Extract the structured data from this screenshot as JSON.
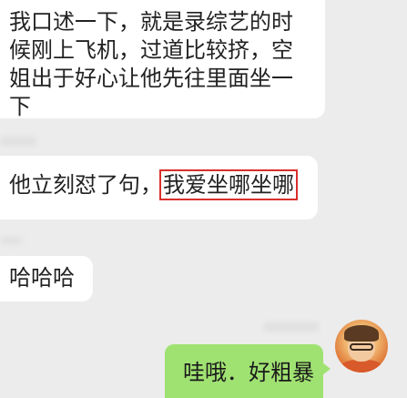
{
  "messages": [
    {
      "direction": "incoming",
      "text": "我口述一下，就是录综艺的时候刚上飞机，过道比较挤，空姐出于好心让他先往里面坐一下"
    },
    {
      "direction": "incoming",
      "prefix": "他立刻怼了句，",
      "highlight": "我爱坐哪坐哪"
    },
    {
      "direction": "incoming",
      "text": "哈哈哈"
    },
    {
      "direction": "outgoing",
      "text": "哇哦．好粗暴"
    }
  ],
  "colors": {
    "background": "#ececec",
    "incoming_bubble": "#ffffff",
    "outgoing_bubble": "#a0e272",
    "highlight_border": "#d9302c"
  },
  "avatar": {
    "icon": "user-avatar-cartoon-icon"
  }
}
